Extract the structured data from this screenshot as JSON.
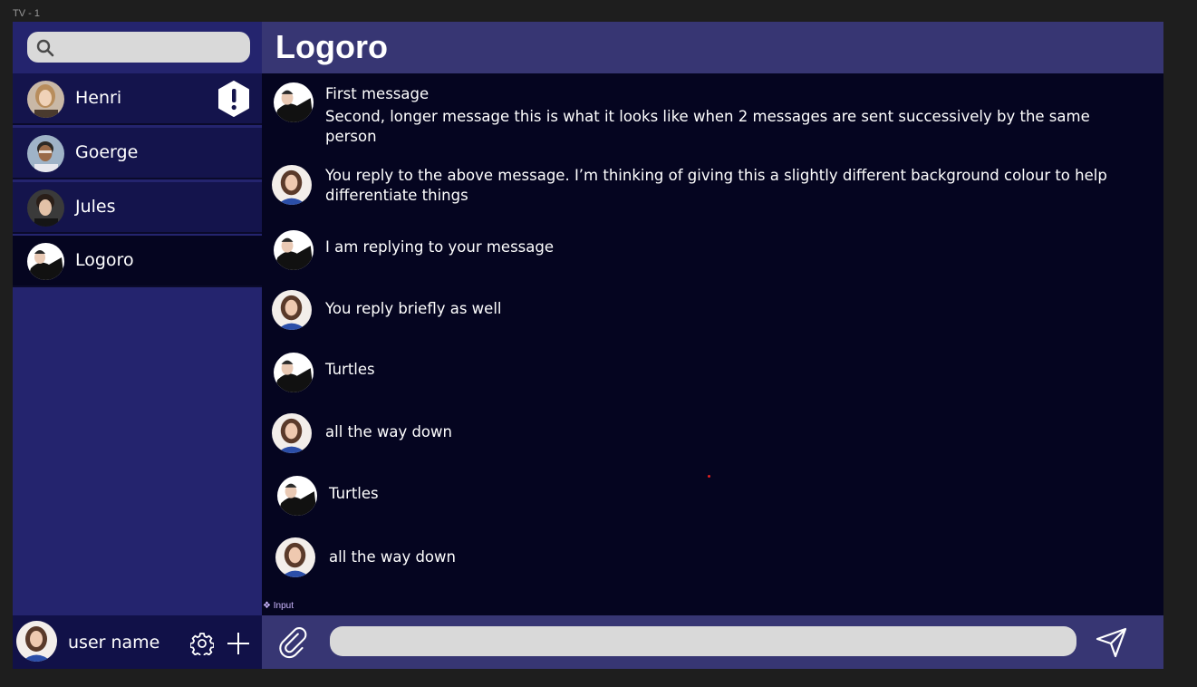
{
  "frame_label": "TV - 1",
  "search": {
    "placeholder": "",
    "value": ""
  },
  "contacts": [
    {
      "name": "Henri",
      "alert": true
    },
    {
      "name": "Goerge",
      "alert": false
    },
    {
      "name": "Jules",
      "alert": false
    },
    {
      "name": "Logoro",
      "alert": false,
      "active": true
    }
  ],
  "alert_icon": "!",
  "user": {
    "name": "user name"
  },
  "header": {
    "title": "Logoro"
  },
  "messages": [
    {
      "from": "Logoro",
      "lines": [
        "First message",
        "Second,  longer message this is what it looks like when 2 messages are sent successively by the same person"
      ]
    },
    {
      "from": "You",
      "text": "You reply to the above message. I’m thinking of giving this a slightly different background colour to help differentiate things"
    },
    {
      "from": "Logoro",
      "text": "I am replying to your message"
    },
    {
      "from": "You",
      "text": "You reply briefly as well"
    },
    {
      "from": "Logoro",
      "text": "Turtles"
    },
    {
      "from": "You",
      "text": "all the way down"
    },
    {
      "from": "Logoro",
      "text": "Turtles"
    },
    {
      "from": "You",
      "text": "all the way down"
    }
  ],
  "input_tag": "❖ Input",
  "composer": {
    "placeholder": "",
    "value": ""
  },
  "colors": {
    "sidebar": "#24246e",
    "contact": "#14144c",
    "active_contact": "#050520",
    "header": "#373673",
    "messages_bg": "#050520",
    "input": "#d9d9d9"
  },
  "icons": [
    "search-icon",
    "alert-icon",
    "gear-icon",
    "plus-icon",
    "paperclip-icon",
    "send-icon"
  ]
}
